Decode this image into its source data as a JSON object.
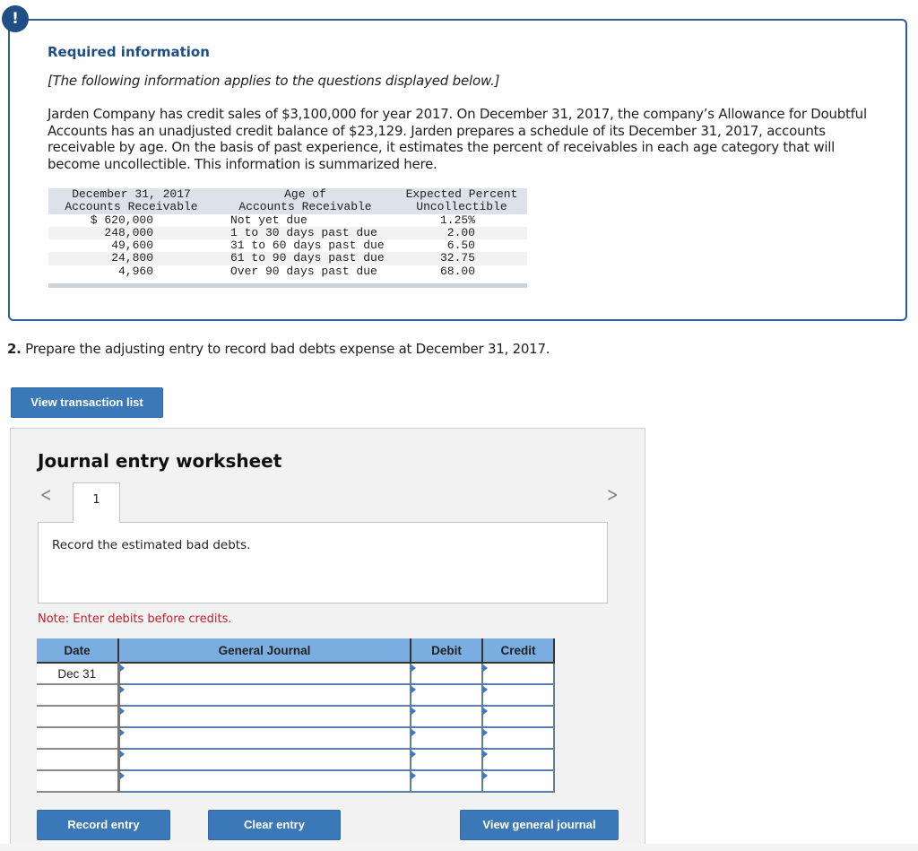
{
  "required_info": {
    "badge_icon": "exclamation-icon",
    "badge_glyph": "!",
    "title": "Required information",
    "subtitle": "[The following information applies to the questions displayed below.]",
    "body": "Jarden Company has credit sales of $3,100,000 for year 2017. On December 31, 2017, the company’s Allowance for Doubtful Accounts has an unadjusted credit balance of $23,129. Jarden prepares a schedule of its December 31, 2017, accounts receivable by age. On the basis of past experience, it estimates the percent of receivables in each age category that will become uncollectible. This information is summarized here.",
    "table": {
      "headers": [
        [
          "December 31, 2017",
          "Accounts Receivable"
        ],
        [
          "Age of",
          "Accounts Receivable"
        ],
        [
          "Expected Percent",
          "Uncollectible"
        ]
      ],
      "rows": [
        {
          "amount": "$ 620,000",
          "age": "Not yet due",
          "percent": "1.25%"
        },
        {
          "amount": "248,000",
          "age": "1 to 30 days past due",
          "percent": "2.00"
        },
        {
          "amount": "49,600",
          "age": "31 to 60 days past due",
          "percent": "6.50"
        },
        {
          "amount": "24,800",
          "age": "61 to 90 days past due",
          "percent": "32.75"
        },
        {
          "amount": "4,960",
          "age": "Over 90 days past due",
          "percent": "68.00"
        }
      ]
    }
  },
  "question": {
    "number": "2.",
    "text": " Prepare the adjusting entry to record bad debts expense at December 31, 2017."
  },
  "buttons": {
    "view_transaction_list": "View transaction list",
    "record_entry": "Record entry",
    "clear_entry": "Clear entry",
    "view_general_journal": "View general journal"
  },
  "worksheet": {
    "title": "Journal entry worksheet",
    "prev_glyph": "<",
    "next_glyph": ">",
    "tabs": [
      {
        "label": "1"
      }
    ],
    "description": "Record the estimated bad debts.",
    "note": "Note: Enter debits before credits.",
    "columns": [
      "Date",
      "General Journal",
      "Debit",
      "Credit"
    ],
    "rows": [
      {
        "date": "Dec 31",
        "account": "",
        "debit": "",
        "credit": ""
      },
      {
        "date": "",
        "account": "",
        "debit": "",
        "credit": ""
      },
      {
        "date": "",
        "account": "",
        "debit": "",
        "credit": ""
      },
      {
        "date": "",
        "account": "",
        "debit": "",
        "credit": ""
      },
      {
        "date": "",
        "account": "",
        "debit": "",
        "credit": ""
      },
      {
        "date": "",
        "account": "",
        "debit": "",
        "credit": ""
      }
    ]
  }
}
